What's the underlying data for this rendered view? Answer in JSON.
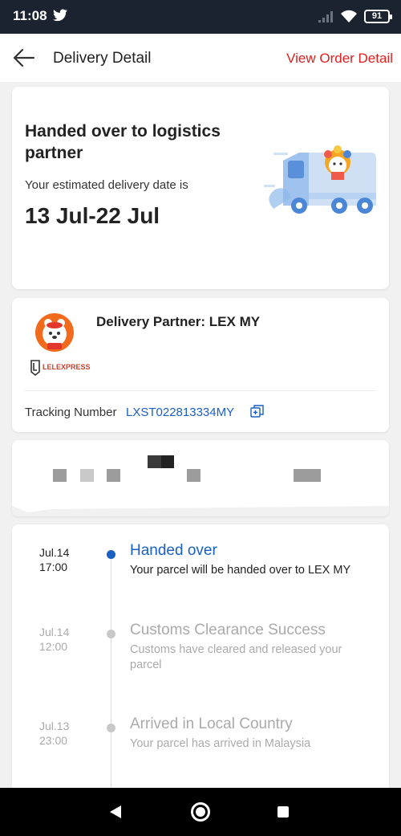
{
  "status_bar": {
    "time": "11:08",
    "battery": "91",
    "icons": [
      "twitter-icon",
      "signal-icon",
      "wifi-icon",
      "battery-icon"
    ]
  },
  "header": {
    "title": "Delivery Detail",
    "link": "View Order Detail",
    "back_icon": "arrow-left-icon"
  },
  "status_card": {
    "title": "Handed over to logistics partner",
    "subtitle": "Your estimated delivery date is",
    "date_range": "13 Jul-22 Jul"
  },
  "partner_card": {
    "partner": "Delivery Partner: LEX MY",
    "brand": "LELEXPRESS",
    "tracking_label": "Tracking Number",
    "tracking_number": "LXST022813334MY"
  },
  "timeline": [
    {
      "date": "Jul.14",
      "time": "17:00",
      "title": "Handed over",
      "desc": "Your parcel will be handed over to LEX MY",
      "active": true
    },
    {
      "date": "Jul.14",
      "time": "12:00",
      "title": "Customs Clearance Success",
      "desc": "Customs have cleared and released your parcel",
      "active": false
    },
    {
      "date": "Jul.13",
      "time": "23:00",
      "title": "Arrived in Local Country",
      "desc": "Your parcel has arrived in Malaysia",
      "active": false
    }
  ],
  "colors": {
    "accent_red": "#e0201f",
    "link_blue": "#1a5fc2",
    "status_bar": "#1b2330"
  }
}
